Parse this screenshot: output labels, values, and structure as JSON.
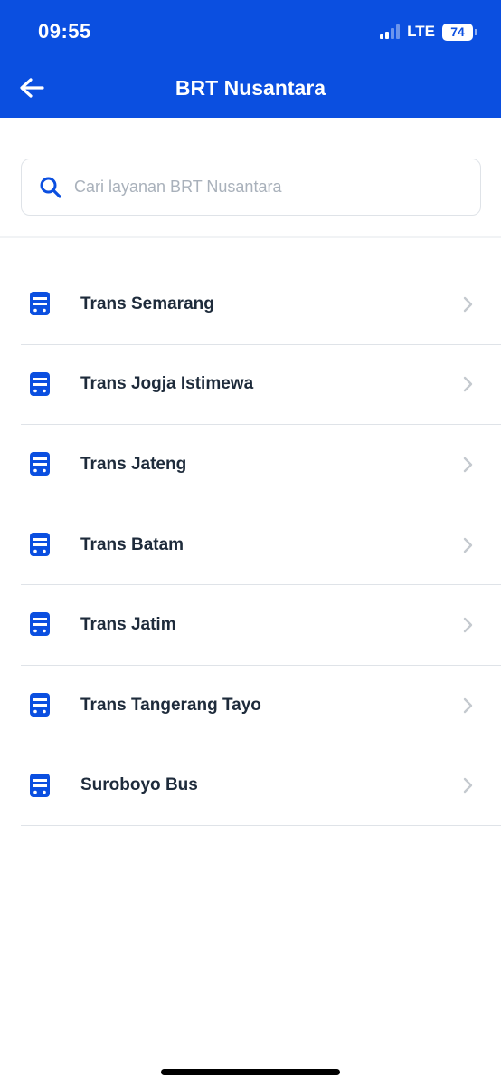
{
  "status_bar": {
    "time": "09:55",
    "network": "LTE",
    "battery": "74"
  },
  "header": {
    "title": "BRT Nusantara",
    "back_icon": "arrow-left-icon",
    "background": "#0b4fe0"
  },
  "search": {
    "placeholder": "Cari layanan BRT Nusantara",
    "value": "",
    "icon": "search-icon"
  },
  "services": [
    {
      "label": "Trans Semarang",
      "icon": "bus-icon"
    },
    {
      "label": "Trans Jogja Istimewa",
      "icon": "bus-icon"
    },
    {
      "label": "Trans Jateng",
      "icon": "bus-icon"
    },
    {
      "label": "Trans Batam",
      "icon": "bus-icon"
    },
    {
      "label": "Trans Jatim",
      "icon": "bus-icon"
    },
    {
      "label": "Trans Tangerang Tayo",
      "icon": "bus-icon"
    },
    {
      "label": "Suroboyo Bus",
      "icon": "bus-icon"
    }
  ],
  "colors": {
    "accent": "#0b4fe0",
    "text": "#1e2b3b",
    "chevron": "#c4c9cf"
  }
}
